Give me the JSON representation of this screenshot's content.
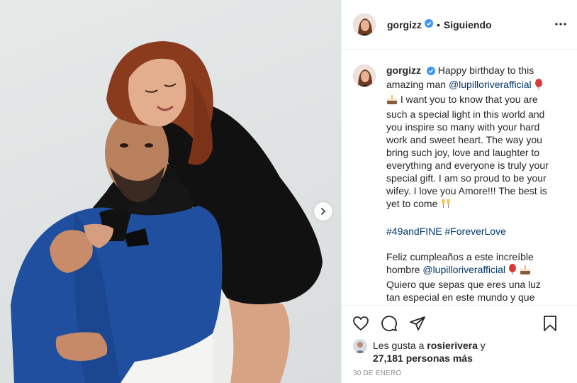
{
  "header": {
    "username": "gorgizz",
    "separator": "•",
    "follow_state": "Siguiendo"
  },
  "caption": {
    "username": "gorgizz",
    "text_1": "Happy birthday to this amazing man",
    "mention_1": "@lupilloriverafficial",
    "text_2": "I want you to know that you are such a special light in this world and you inspire so many with your hard work and sweet heart. The way you bring such joy, love and laughter to everything and everyone is truly your special gift. I am so proud to be your wifey. I love you Amore!!! The best is yet to come",
    "hashtag_1": "#49andFINE",
    "hashtag_2": "#ForeverLove",
    "text_es_1": "Feliz cumpleaños a este increíble hombre",
    "mention_2": "@lupilloriverafficial",
    "text_es_2": "Quiero que sepas que eres una luz tan especial en este mundo y que inspiras a muchos con tu arduo trabajo y tu"
  },
  "likes": {
    "prefix": "Les gusta a",
    "liker": "rosierivera",
    "connector": "y",
    "count": "27,181 personas más"
  },
  "date": "30 de enero",
  "colors": {
    "verified": "#3897f0",
    "link": "#00376b",
    "jacket": "#1f4f9e",
    "dress": "#111111",
    "hair": "#8a3b1e"
  },
  "icons": {
    "verified": "verified-badge-icon",
    "more": "more-options-icon",
    "next": "chevron-right-icon",
    "like": "heart-icon",
    "comment": "comment-icon",
    "share": "paper-plane-icon",
    "save": "bookmark-icon"
  }
}
